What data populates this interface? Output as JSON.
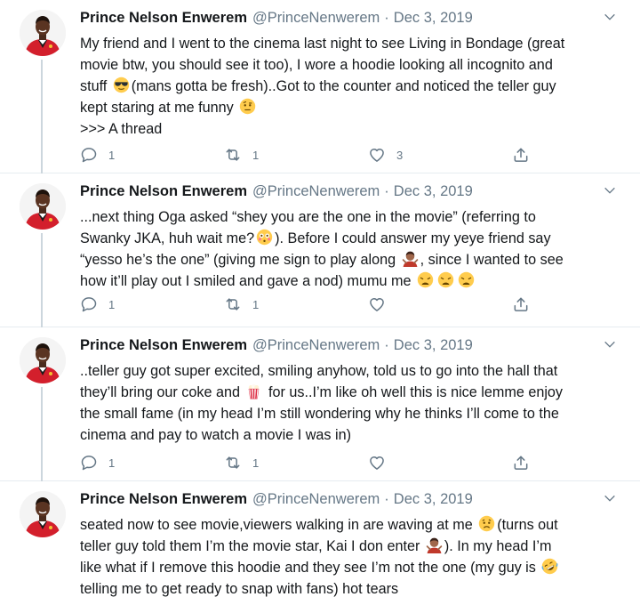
{
  "colors": {
    "accent": "#1da1f2",
    "secondary_text": "#657786",
    "text": "#14171a",
    "thread_line": "#ccd6dd"
  },
  "tweets": [
    {
      "name": "Prince Nelson Enwerem",
      "handle": "@PrinceNenwerem",
      "dot": "·",
      "date": "Dec 3, 2019",
      "lines": [
        [
          "My friend and I went to the cinema last night to see Living in Bondage (great"
        ],
        [
          "movie btw, you should see it too), I wore a hoodie looking all incognito and"
        ],
        [
          "stuff ",
          {
            "emoji": "sunglasses-face-emoji"
          },
          "(mans gotta be fresh)..Got to the counter and noticed the teller guy"
        ],
        [
          "kept staring at me funny ",
          {
            "emoji": "raised-eyebrow-face-emoji"
          }
        ],
        [
          ">>> A thread"
        ]
      ],
      "reply_count": "1",
      "retweet_count": "1",
      "like_count": "3"
    },
    {
      "name": "Prince Nelson Enwerem",
      "handle": "@PrinceNenwerem",
      "dot": "·",
      "date": "Dec 3, 2019",
      "lines": [
        [
          "...next thing Oga asked “shey you are the one in the movie” (referring to"
        ],
        [
          "Swanky JKA, huh wait me?",
          {
            "emoji": "flushed-face-emoji"
          },
          "). Before I could answer my yeye friend say"
        ],
        [
          "“yesso he’s the one” (giving me sign to play along ",
          {
            "emoji": "man-shrugging-emoji"
          },
          ", since I wanted to see"
        ],
        [
          "how it’ll play out I smiled and gave a nod) mumu me ",
          {
            "emoji": "weary-face-emoji"
          },
          {
            "emoji": "weary-face-emoji"
          },
          {
            "emoji": "weary-face-emoji"
          }
        ]
      ],
      "reply_count": "1",
      "retweet_count": "1",
      "like_count": ""
    },
    {
      "name": "Prince Nelson Enwerem",
      "handle": "@PrinceNenwerem",
      "dot": "·",
      "date": "Dec 3, 2019",
      "lines": [
        [
          "..teller guy got super excited, smiling anyhow, told us to go into the hall that"
        ],
        [
          "they’ll bring our coke and ",
          {
            "emoji": "popcorn-emoji"
          },
          " for us..I’m like oh well this is nice lemme enjoy"
        ],
        [
          "the small fame (in my head I’m still wondering why he thinks I’ll come to the"
        ],
        [
          "cinema and pay to watch a movie I was in)"
        ]
      ],
      "reply_count": "1",
      "retweet_count": "1",
      "like_count": ""
    },
    {
      "name": "Prince Nelson Enwerem",
      "handle": "@PrinceNenwerem",
      "dot": "·",
      "date": "Dec 3, 2019",
      "lines": [
        [
          "seated now to see movie,viewers walking in are waving at me ",
          {
            "emoji": "worried-face-emoji"
          },
          "(turns out"
        ],
        [
          "teller guy told them I’m the movie star, Kai I don enter ",
          {
            "emoji": "man-shrugging-emoji"
          },
          "). In my head I’m"
        ],
        [
          "like what if I remove this hoodie and they see I’m not the one (my guy is ",
          {
            "emoji": "rofl-face-emoji"
          }
        ],
        [
          "telling me to get ready to snap with fans) hot tears"
        ]
      ],
      "reply_count": "",
      "retweet_count": "",
      "like_count": ""
    }
  ]
}
